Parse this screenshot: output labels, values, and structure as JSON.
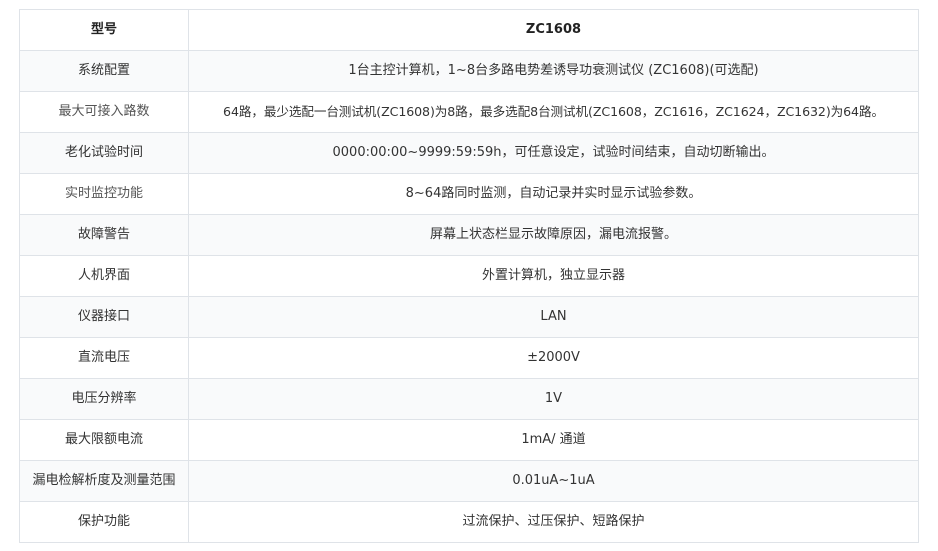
{
  "spec_table": {
    "header": {
      "label": "型号",
      "value": "ZC1608"
    },
    "rows": [
      {
        "label": "系统配置",
        "value": "1台主控计算机，1~8台多路电势差诱导功衰测试仪 (ZC1608)(可选配)"
      },
      {
        "label": "最大可接入路数",
        "value": "64路，最少选配一台测试机(ZC1608)为8路，最多选配8台测试机(ZC1608，ZC1616，ZC1624，ZC1632)为64路。"
      },
      {
        "label": "老化试验时间",
        "value": "0000:00:00~9999:59:59h，可任意设定，试验时间结束，自动切断输出。"
      },
      {
        "label": "实时监控功能",
        "value": "8~64路同时监测，自动记录并实时显示试验参数。"
      },
      {
        "label": "故障警告",
        "value": "屏幕上状态栏显示故障原因，漏电流报警。"
      },
      {
        "label": "人机界面",
        "value": "外置计算机，独立显示器"
      },
      {
        "label": "仪器接口",
        "value": "LAN"
      },
      {
        "label": "直流电压",
        "value": "±2000V"
      },
      {
        "label": "电压分辨率",
        "value": "1V"
      },
      {
        "label": "最大限额电流",
        "value": "1mA/ 通道"
      },
      {
        "label": "漏电检解析度及测量范围",
        "value": "0.01uA~1uA"
      },
      {
        "label": "保护功能",
        "value": "过流保护、过压保护、短路保护"
      }
    ]
  }
}
